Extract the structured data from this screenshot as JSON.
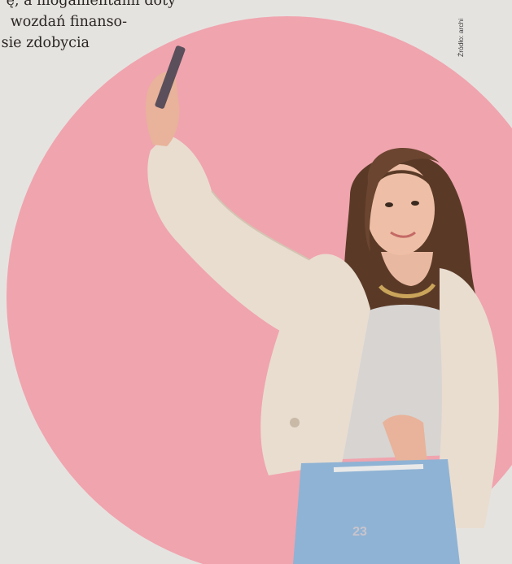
{
  "article": {
    "lines": [
      "ę, a mogamentami doty",
      "wozdań finanso-",
      "sie zdobycia"
    ]
  },
  "source_credit": "Źródło: archi",
  "page_number": "23",
  "colors": {
    "background": "#e5e3e0",
    "circle": "#f0a4ae",
    "blazer": "#e9ddd0",
    "jeans": "#8fb3d4"
  }
}
